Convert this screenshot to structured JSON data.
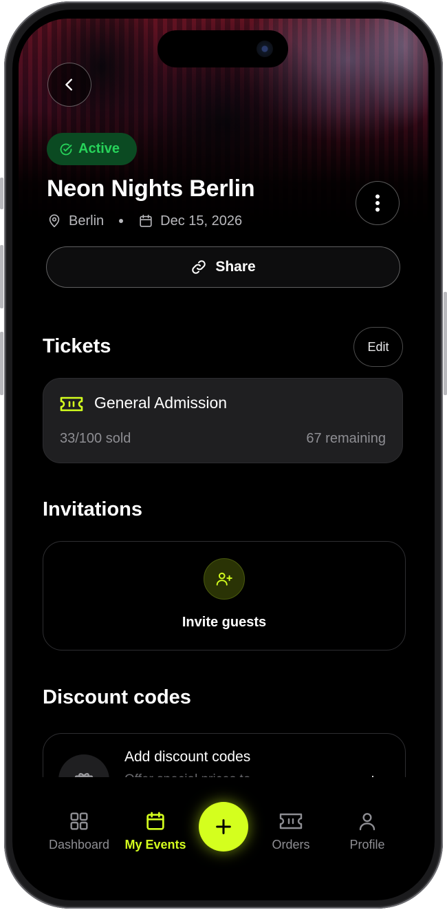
{
  "event": {
    "status": "Active",
    "title": "Neon Nights Berlin",
    "location": "Berlin",
    "date": "Dec 15, 2026"
  },
  "actions": {
    "share_label": "Share"
  },
  "tickets": {
    "section_title": "Tickets",
    "edit_label": "Edit",
    "items": [
      {
        "name": "General Admission",
        "sold": "33/100 sold",
        "remaining": "67 remaining",
        "icon": "ticket-icon"
      }
    ]
  },
  "invitations": {
    "section_title": "Invitations",
    "invite_label": "Invite guests",
    "icon": "user-plus-icon"
  },
  "discounts": {
    "section_title": "Discount codes",
    "add_title": "Add discount codes",
    "add_subtitle": "Offer special prices to",
    "icon": "gift-icon"
  },
  "nav": {
    "items": [
      {
        "label": "Dashboard",
        "icon": "grid-icon",
        "active": false
      },
      {
        "label": "My Events",
        "icon": "calendar-icon",
        "active": true
      },
      {
        "label": "Orders",
        "icon": "ticket-icon",
        "active": false
      },
      {
        "label": "Profile",
        "icon": "user-icon",
        "active": false
      }
    ],
    "fab_icon": "plus-icon"
  },
  "colors": {
    "accent": "#d4ff1e",
    "status_green": "#27d35a",
    "status_bg": "#0b4a22",
    "background": "#000000"
  }
}
